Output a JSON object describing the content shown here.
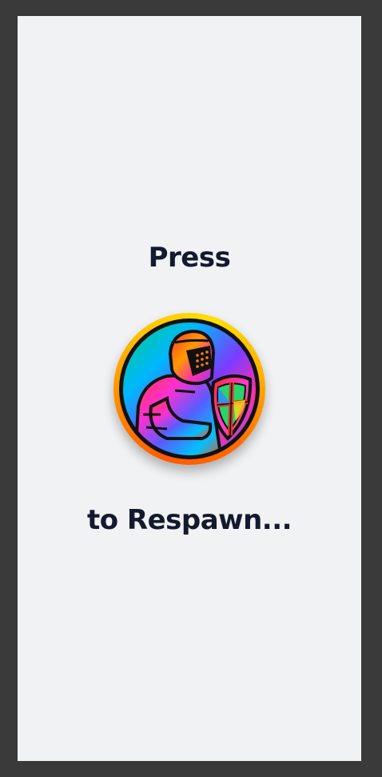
{
  "screen": {
    "press_text": "Press",
    "respawn_text": "to Respawn..."
  },
  "button": {
    "icon": "knight-avatar-icon",
    "ring_color": "#ffb000"
  },
  "colors": {
    "background": "#f1f2f4",
    "text": "#131a2e",
    "frame": "#3a3a3a"
  }
}
